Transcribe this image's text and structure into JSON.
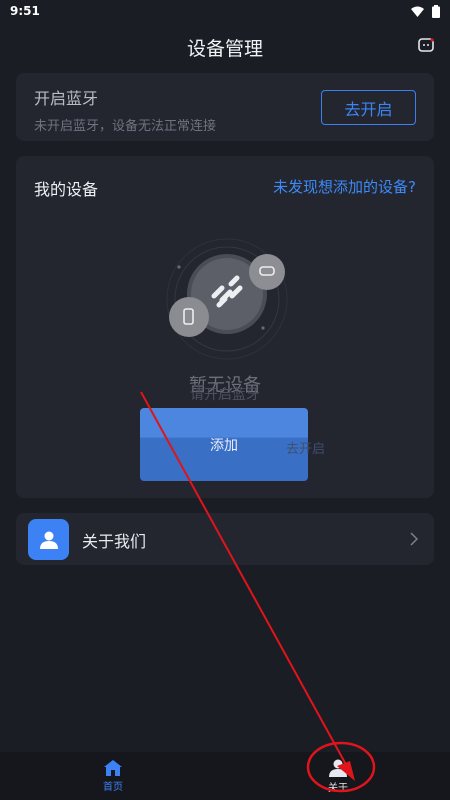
{
  "status_bar": {
    "time": "9:51"
  },
  "header": {
    "title": "设备管理",
    "icons": [
      "message-icon"
    ]
  },
  "bluetooth": {
    "title": "开启蓝牙",
    "subtitle": "未开启蓝牙，设备无法正常连接",
    "button": "去开启"
  },
  "devices": {
    "title": "我的设备",
    "link": "未发现想添加的设备?",
    "empty_title": "暂无设备",
    "empty_sub": "请开启蓝牙",
    "ghost_link": "去开启",
    "add_button": "添加"
  },
  "about": {
    "label": "关于我们"
  },
  "tabs": [
    {
      "label": "首页",
      "icon": "home-icon",
      "active": true
    },
    {
      "label": "关于",
      "icon": "user-icon",
      "active": false
    }
  ],
  "colors": {
    "accent": "#3d82f5",
    "annotation": "#e0141b",
    "background": "#1b1d24"
  }
}
